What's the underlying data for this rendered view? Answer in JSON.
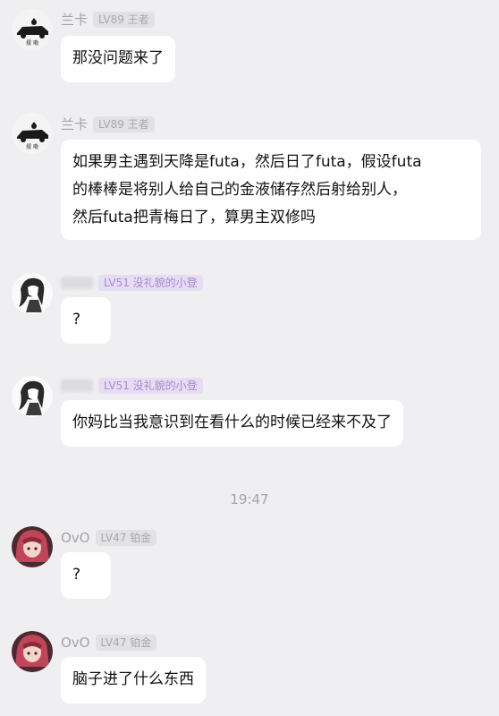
{
  "messages": [
    {
      "avatar_icon": "cat-car-avatar",
      "avatar_caption": "摆 嘞",
      "name": "兰卡",
      "badge": "LV89 王者",
      "badge_style": "gray",
      "text": "那没问题来了"
    },
    {
      "avatar_icon": "cat-car-avatar",
      "avatar_caption": "摆 嘞",
      "name": "兰卡",
      "badge": "LV89 王者",
      "badge_style": "gray",
      "text": "如果男主遇到天降是futa，然后日了futa，假设futa\n的棒棒是将别人给自己的金液储存然后射给别人，\n然后futa把青梅日了，算男主双修吗"
    },
    {
      "avatar_icon": "anime-girl-avatar",
      "name": "",
      "badge": "LV51 没礼貌的小登",
      "badge_style": "purple",
      "text": "?"
    },
    {
      "avatar_icon": "anime-girl-avatar",
      "name": "",
      "badge": "LV51 没礼貌的小登",
      "badge_style": "purple",
      "text": "你妈比当我意识到在看什么的时候已经来不及了"
    },
    {
      "avatar_icon": "red-hair-girl-avatar",
      "name": "OvO",
      "badge": "LV47 铂金",
      "badge_style": "gray",
      "text": "?"
    },
    {
      "avatar_icon": "red-hair-girl-avatar",
      "name": "OvO",
      "badge": "LV47 铂金",
      "badge_style": "gray",
      "text": "脑子进了什么东西"
    }
  ],
  "timestamp": "19:47"
}
